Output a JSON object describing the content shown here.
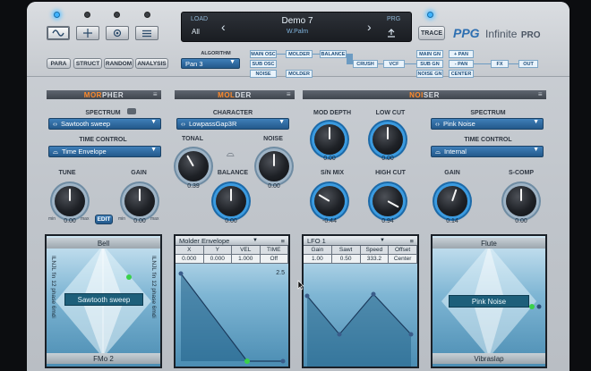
{
  "header": {
    "load_label": "LOAD",
    "load_value": "All",
    "preset_name": "Demo 7",
    "preset_author": "W.Palm",
    "prg_label": "PRG",
    "trace_label": "TRACE",
    "brand": "PPG",
    "product": "Infinite",
    "product_suffix": "PRO",
    "view_buttons": [
      "PARA",
      "STRUCT",
      "RANDOM",
      "ANALYSIS"
    ],
    "top_tab_icons": [
      "wave-icon",
      "crosshair-icon",
      "record-icon",
      "list-icon"
    ]
  },
  "routing": {
    "algorithm_label": "ALGORITHM",
    "algorithm_value": "Pan 3",
    "left_col": [
      "MAIN OSC",
      "SUB OSC",
      "NOISE"
    ],
    "molder": [
      "MOLDER",
      "MOLDER"
    ],
    "balance": "BALANCE",
    "crush": "CRUSH",
    "vcf": "VCF",
    "gains": [
      "MAIN GN",
      "SUB GN",
      "NOISE GN"
    ],
    "pans": [
      "+ PAN",
      "- PAN",
      "CENTER"
    ],
    "fx": "FX",
    "out": "OUT"
  },
  "morpher": {
    "title_hl": "MOR",
    "title_rest": "PHER",
    "spectrum_label": "SPECTRUM",
    "spectrum_value": "Sawtooth sweep",
    "time_control_label": "TIME CONTROL",
    "time_control_value": "Time Envelope",
    "tune_label": "TUNE",
    "tune_value": "0.00",
    "tune_level": 0.5,
    "gain_label": "GAIN",
    "gain_value": "0.00",
    "gain_level": 0.5,
    "edit_label": "EDIT",
    "min": "min",
    "max": "max"
  },
  "molder": {
    "title_hl": "MOL",
    "title_rest": "DER",
    "character_label": "CHARACTER",
    "character_value": "LowpassGap3R",
    "tonal_label": "TONAL",
    "tonal_value": "0.39",
    "tonal_level": 0.39,
    "noise_label": "NOISE",
    "noise_value": "0.00",
    "noise_level": 0.5,
    "balance_label": "BALANCE",
    "balance_value": "0.00",
    "balance_level": 0.5
  },
  "noiser": {
    "title_hl": "NOI",
    "title_rest": "SER",
    "mod_depth_label": "MOD DEPTH",
    "mod_depth_value": "0.00",
    "mod_depth_level": 0.5,
    "low_cut_label": "LOW CUT",
    "low_cut_value": "0.00",
    "low_cut_level": 0.5,
    "sn_mix_label": "S/N MIX",
    "sn_mix_value": "-0.44",
    "sn_mix_level": 0.28,
    "high_cut_label": "HIGH CUT",
    "high_cut_value": "0.94",
    "high_cut_level": 0.94,
    "spectrum_label": "SPECTRUM",
    "spectrum_value": "Pink Noise",
    "time_control_label": "TIME CONTROL",
    "time_control_value": "Internal",
    "gain_label": "GAIN",
    "gain_value": "0.14",
    "gain_level": 0.57,
    "scomp_label": "S-COMP",
    "scomp_value": "0.00",
    "scomp_level": 0.5
  },
  "pads": {
    "left": {
      "top": "Bell",
      "center": "Sawtooth sweep",
      "bottom": "FMo 2",
      "side_text": "ILNJL fin 12 phase 6mdi"
    },
    "right": {
      "top": "Flute",
      "center": "Pink Noise",
      "bottom": "Vibraslap"
    }
  },
  "molder_env": {
    "title": "Molder Envelope",
    "headers": [
      "X",
      "Y",
      "VEL",
      "TIME"
    ],
    "values": [
      "0.000",
      "0.000",
      "1.000",
      "Off"
    ],
    "readout": "2.5"
  },
  "lfo": {
    "title": "LFO 1",
    "headers": [
      "Gain",
      "Sawt",
      "Speed",
      "Offset"
    ],
    "values": [
      "1.00",
      "0.50",
      "333.2",
      "Center"
    ]
  },
  "menu_glyph": "≡",
  "colors": {
    "accent_orange": "#ff8a2a",
    "dropdown_blue": "#2f6da3",
    "led_blue": "#3fb4ff"
  }
}
